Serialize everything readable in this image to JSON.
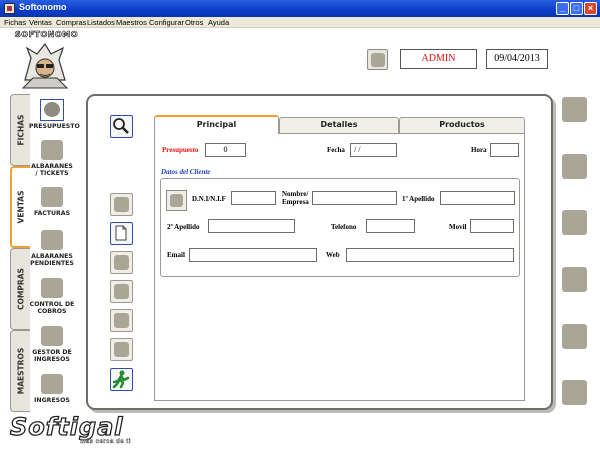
{
  "window": {
    "title": "Softonomo",
    "minimize": "_",
    "maximize": "□",
    "close": "×"
  },
  "menu": [
    "Fichas",
    "Ventas",
    "Compras",
    "Listados",
    "Maestros",
    "Configurar",
    "Otros",
    "Ayuda"
  ],
  "logo": {
    "word": "SOFTONOMO"
  },
  "header": {
    "user": "ADMIN",
    "date": "09/04/2013"
  },
  "side_tabs": [
    "FICHAS",
    "VENTAS",
    "COMPRAS",
    "MAESTROS"
  ],
  "side_items": [
    {
      "label": "PRESUPUESTO"
    },
    {
      "label": "ALBARANES / TICKETS"
    },
    {
      "label": "FACTURAS"
    },
    {
      "label": "ALBARANES PENDIENTES"
    },
    {
      "label": "CONTROL DE COBROS"
    },
    {
      "label": "GESTOR DE INGRESOS"
    },
    {
      "label": "INGRESOS"
    }
  ],
  "tabs": [
    "Principal",
    "Detalles",
    "Productos"
  ],
  "form": {
    "presupuesto_label": "Presupuesto",
    "presupuesto_value": "0",
    "fecha_label": "Fecha",
    "fecha_value": " / /",
    "hora_label": "Hora",
    "hora_value": "",
    "group_title": "Datos del Cliente",
    "dni_label": "D.N.I/N.I.F",
    "dni_value": "",
    "nombre_label_1": "Nombre/",
    "nombre_label_2": "Empresa",
    "nombre_value": "",
    "apellido1_label": "1º Apellido",
    "apellido1_value": "",
    "apellido2_label": "2º Apellido",
    "apellido2_value": "",
    "telefono_label": "Telefono",
    "telefono_value": "",
    "movil_label": "Movil",
    "movil_value": "",
    "email_label": "Email",
    "email_value": "",
    "web_label": "Web",
    "web_value": ""
  },
  "footer": {
    "brand": "Softigal",
    "slogan": "más cerca de ti"
  },
  "colors": {
    "accent_tab": "#f0a034",
    "label_red": "#e01010",
    "group_title": "#2042b0",
    "titlebar": "#0a3cc8"
  }
}
